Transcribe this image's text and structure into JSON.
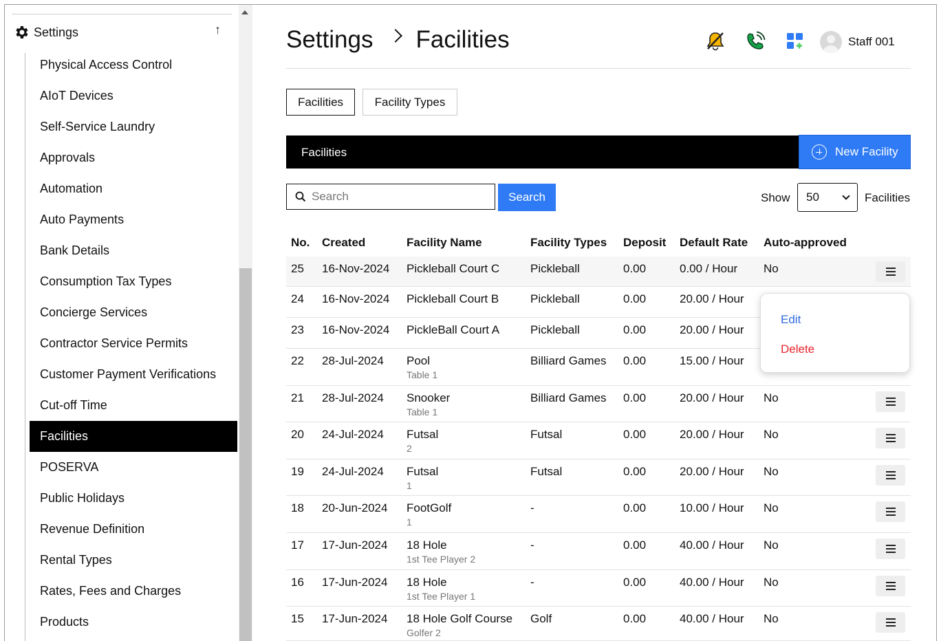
{
  "sidebar": {
    "header": "Settings",
    "collapse_icon": "↑",
    "items": [
      {
        "label": "Physical Access Control",
        "active": false
      },
      {
        "label": "AIoT Devices",
        "active": false
      },
      {
        "label": "Self-Service Laundry",
        "active": false
      },
      {
        "label": "Approvals",
        "active": false
      },
      {
        "label": "Automation",
        "active": false
      },
      {
        "label": "Auto Payments",
        "active": false
      },
      {
        "label": "Bank Details",
        "active": false
      },
      {
        "label": "Consumption Tax Types",
        "active": false
      },
      {
        "label": "Concierge Services",
        "active": false
      },
      {
        "label": "Contractor Service Permits",
        "active": false
      },
      {
        "label": "Customer Payment Verifications",
        "active": false
      },
      {
        "label": "Cut-off Time",
        "active": false
      },
      {
        "label": "Facilities",
        "active": true
      },
      {
        "label": "POSERVA",
        "active": false
      },
      {
        "label": "Public Holidays",
        "active": false
      },
      {
        "label": "Revenue Definition",
        "active": false
      },
      {
        "label": "Rental Types",
        "active": false
      },
      {
        "label": "Rates, Fees and Charges",
        "active": false
      },
      {
        "label": "Products",
        "active": false
      }
    ]
  },
  "header": {
    "crumb_root": "Settings",
    "crumb_current": "Facilities",
    "user_name": "Staff 001",
    "icons": [
      "bell-off-icon",
      "phone-call-icon",
      "apps-grid-icon"
    ],
    "colors": {
      "bell": "#f5b400",
      "phone": "#16a34a",
      "grid": "#2f7bf5"
    }
  },
  "tabs": [
    {
      "label": "Facilities",
      "active": true
    },
    {
      "label": "Facility Types",
      "active": false
    }
  ],
  "panel": {
    "title": "Facilities",
    "new_button": "New Facility"
  },
  "search": {
    "placeholder": "Search",
    "value": "",
    "button": "Search",
    "show_label": "Show",
    "show_value": "50",
    "suffix_label": "Facilities"
  },
  "table": {
    "columns": [
      "No.",
      "Created",
      "Facility Name",
      "Facility Types",
      "Deposit",
      "Default Rate",
      "Auto-approved"
    ],
    "rows": [
      {
        "no": "25",
        "created": "16-Nov-2024",
        "name": "Pickleball Court C",
        "sub": "",
        "type": "Pickleball",
        "deposit": "0.00",
        "rate": "0.00 / Hour",
        "auto": "No"
      },
      {
        "no": "24",
        "created": "16-Nov-2024",
        "name": "Pickleball Court B",
        "sub": "",
        "type": "Pickleball",
        "deposit": "0.00",
        "rate": "20.00 / Hour",
        "auto": ""
      },
      {
        "no": "23",
        "created": "16-Nov-2024",
        "name": "PickleBall Court A",
        "sub": "",
        "type": "Pickleball",
        "deposit": "0.00",
        "rate": "20.00 / Hour",
        "auto": ""
      },
      {
        "no": "22",
        "created": "28-Jul-2024",
        "name": "Pool",
        "sub": "Table 1",
        "type": "Billiard Games",
        "deposit": "0.00",
        "rate": "15.00 / Hour",
        "auto": ""
      },
      {
        "no": "21",
        "created": "28-Jul-2024",
        "name": "Snooker",
        "sub": "Table 1",
        "type": "Billiard Games",
        "deposit": "0.00",
        "rate": "20.00 / Hour",
        "auto": "No"
      },
      {
        "no": "20",
        "created": "24-Jul-2024",
        "name": "Futsal",
        "sub": "2",
        "type": "Futsal",
        "deposit": "0.00",
        "rate": "20.00 / Hour",
        "auto": "No"
      },
      {
        "no": "19",
        "created": "24-Jul-2024",
        "name": "Futsal",
        "sub": "1",
        "type": "Futsal",
        "deposit": "0.00",
        "rate": "20.00 / Hour",
        "auto": "No"
      },
      {
        "no": "18",
        "created": "20-Jun-2024",
        "name": "FootGolf",
        "sub": "1",
        "type": "-",
        "deposit": "0.00",
        "rate": "10.00 / Hour",
        "auto": "No"
      },
      {
        "no": "17",
        "created": "17-Jun-2024",
        "name": "18 Hole",
        "sub": "1st Tee Player 2",
        "type": "-",
        "deposit": "0.00",
        "rate": "40.00 / Hour",
        "auto": "No"
      },
      {
        "no": "16",
        "created": "17-Jun-2024",
        "name": "18 Hole",
        "sub": "1st Tee Player 1",
        "type": "-",
        "deposit": "0.00",
        "rate": "40.00 / Hour",
        "auto": "No"
      },
      {
        "no": "15",
        "created": "17-Jun-2024",
        "name": "18 Hole Golf Course",
        "sub": "Golfer 2",
        "type": "Golf",
        "deposit": "0.00",
        "rate": "40.00 / Hour",
        "auto": "No"
      }
    ]
  },
  "row_menu": {
    "edit": "Edit",
    "delete": "Delete"
  }
}
